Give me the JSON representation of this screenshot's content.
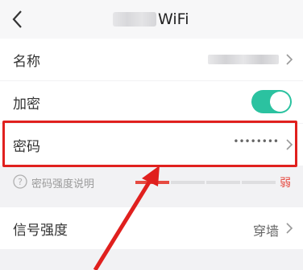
{
  "header": {
    "title": "WiFi",
    "icons": {
      "back": "chevron-left-icon"
    }
  },
  "rows": {
    "name": {
      "label": "名称",
      "icon": "chevron-right-icon"
    },
    "encrypt": {
      "label": "加密",
      "toggle_on": true,
      "toggle_color": "#2bc2a0"
    },
    "password": {
      "label": "密码",
      "value": "••••••••",
      "icon": "chevron-right-icon"
    },
    "signal": {
      "label": "信号强度",
      "value": "穿墙",
      "icon": "chevron-right-icon"
    }
  },
  "password_hint": {
    "text": "密码强度说明",
    "icon": "question-circle-icon",
    "strength_label": "弱",
    "strength_segments_total": 4,
    "strength_segments_filled": 1,
    "strength_color": "#e64a40"
  },
  "annotations": {
    "highlight_color": "#e0201e"
  }
}
